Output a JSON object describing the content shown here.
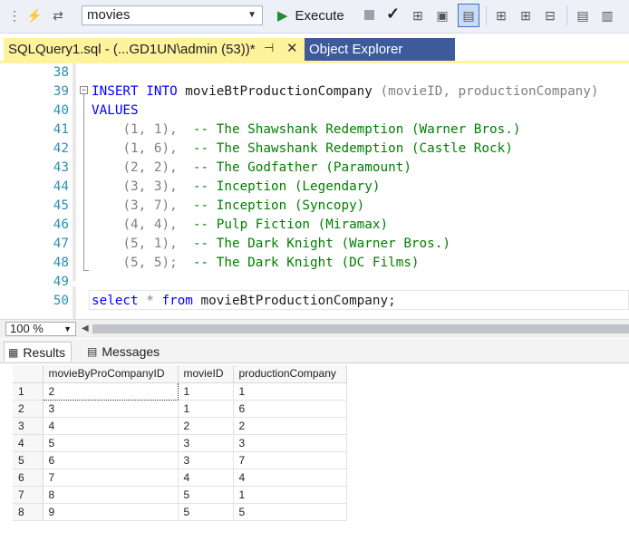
{
  "toolbar": {
    "database": "movies",
    "execute_label": "Execute"
  },
  "tabs": {
    "active_label": "SQLQuery1.sql - (...GD1UN\\admin (53))*",
    "pin_icon": "pin-icon",
    "close_icon": "close-icon",
    "inactive_label": "Object Explorer"
  },
  "editor": {
    "line_numbers": [
      "38",
      "39",
      "40",
      "41",
      "42",
      "43",
      "44",
      "45",
      "46",
      "47",
      "48",
      "49",
      "50"
    ],
    "insert_kw": "INSERT INTO",
    "insert_rest": " movieBtProductionCompany ",
    "insert_cols": "(movieID, productionCompany)",
    "values_kw": "VALUES",
    "rows": [
      {
        "tuple": "(1, 1),",
        "comment": "-- The Shawshank Redemption (Warner Bros.)"
      },
      {
        "tuple": "(1, 6),",
        "comment": "-- The Shawshank Redemption (Castle Rock)"
      },
      {
        "tuple": "(2, 2),",
        "comment": "-- The Godfather (Paramount)"
      },
      {
        "tuple": "(3, 3),",
        "comment": "-- Inception (Legendary)"
      },
      {
        "tuple": "(3, 7),",
        "comment": "-- Inception (Syncopy)"
      },
      {
        "tuple": "(4, 4),",
        "comment": "-- Pulp Fiction (Miramax)"
      },
      {
        "tuple": "(5, 1),",
        "comment": "-- The Dark Knight (Warner Bros.)"
      },
      {
        "tuple": "(5, 5);",
        "comment": "-- The Dark Knight (DC Films)"
      }
    ],
    "select_kw": "select",
    "star": " * ",
    "from_kw": "from",
    "select_rest": " movieBtProductionCompany;"
  },
  "zoom": "100 %",
  "results_tabs": {
    "results": "Results",
    "messages": "Messages"
  },
  "grid": {
    "columns": [
      "movieByProCompanyID",
      "movieID",
      "productionCompany"
    ],
    "rows": [
      [
        "1",
        "2",
        "1",
        "1"
      ],
      [
        "2",
        "3",
        "1",
        "6"
      ],
      [
        "3",
        "4",
        "2",
        "2"
      ],
      [
        "4",
        "5",
        "3",
        "3"
      ],
      [
        "5",
        "6",
        "3",
        "7"
      ],
      [
        "6",
        "7",
        "4",
        "4"
      ],
      [
        "7",
        "8",
        "5",
        "1"
      ],
      [
        "8",
        "9",
        "5",
        "5"
      ]
    ]
  },
  "colors": {
    "keyword": "#0000ff",
    "comment": "#008000",
    "line_number": "#2b91af",
    "active_tab": "#fff29d",
    "inactive_tab": "#3d5a9b"
  }
}
